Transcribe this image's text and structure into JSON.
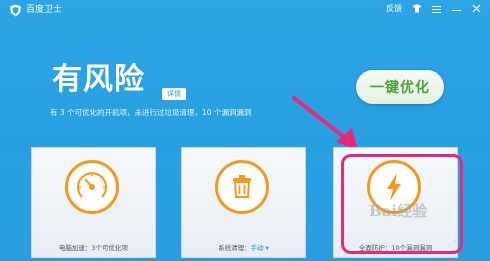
{
  "app": {
    "title": "百度卫士"
  },
  "titlebar": {
    "feedback_label": "反馈"
  },
  "status": {
    "headline": "有风险",
    "detail_tag": "详情",
    "description": "有 3 个可优化的开机项，未进行过垃圾清理，10 个漏洞漏洞"
  },
  "optimize_button": {
    "label": "一键优化"
  },
  "cards": [
    {
      "label": "电脑加速：3个可优化项",
      "icon": "speedometer-icon"
    },
    {
      "label_prefix": "系统清理：",
      "label_link": "手动 ▾",
      "icon": "trash-can-icon"
    },
    {
      "label": "全面防护：10个漏洞漏洞",
      "icon": "lightning-bolt-icon"
    }
  ],
  "watermark": {
    "text": "Bai经验"
  },
  "colors": {
    "accent_orange": "#f39a1e",
    "bg_blue": "#2a9ddf",
    "button_green": "#43a63a",
    "annotation_pink": "#e8287a"
  }
}
